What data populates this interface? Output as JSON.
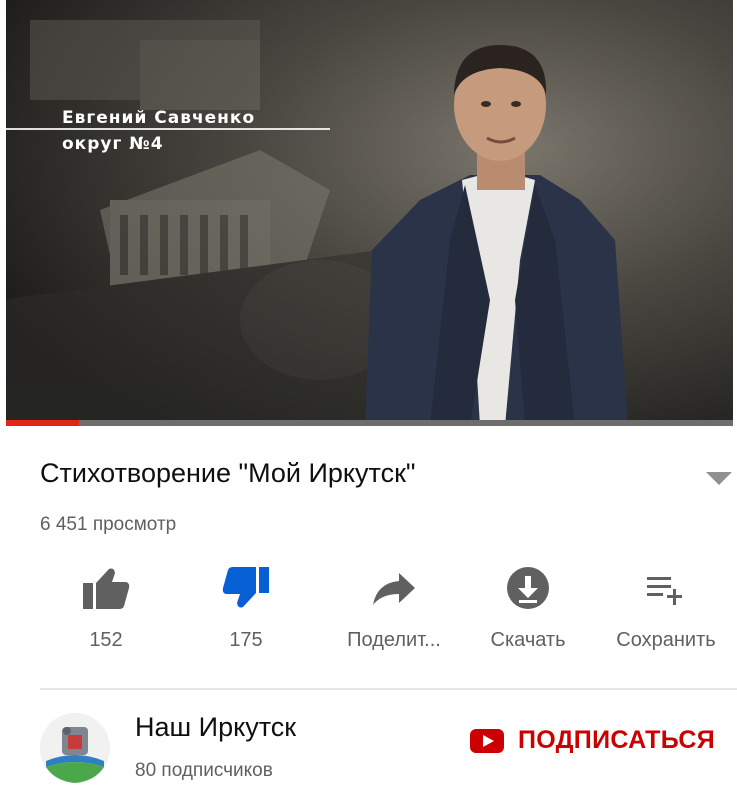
{
  "video": {
    "overlay_name": "Евгений Савченко",
    "overlay_district": "округ №4",
    "progress": 0.1,
    "progress_color": "#e1251b"
  },
  "title": "Стихотворение \"Мой Иркутск\"",
  "views": "6 451 просмотр",
  "actions": [
    {
      "icon": "thumbs-up-icon",
      "label": "152",
      "color": "#606060"
    },
    {
      "icon": "thumbs-down-icon",
      "label": "175",
      "color": "#065fd4"
    },
    {
      "icon": "share-icon",
      "label": "Поделит..."
    },
    {
      "icon": "download-icon",
      "label": "Скачать"
    },
    {
      "icon": "playlist-add-icon",
      "label": "Сохранить"
    }
  ],
  "channel": {
    "name": "Наш Иркутск",
    "subscribers": "80 подписчиков",
    "subscribe_label": "ПОДПИСАТЬСЯ",
    "subscribe_color": "#cc0000"
  }
}
